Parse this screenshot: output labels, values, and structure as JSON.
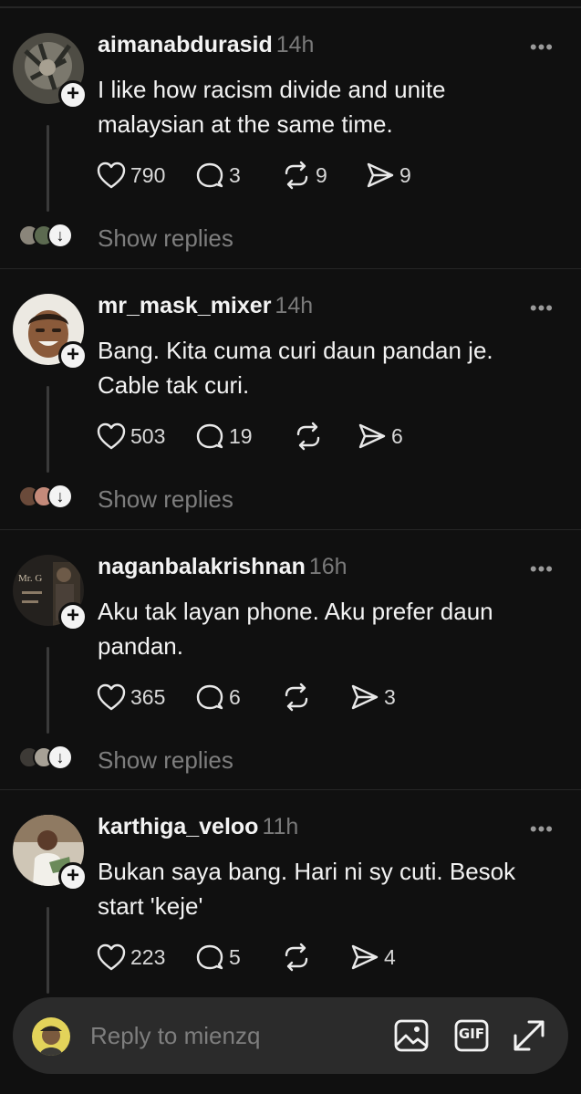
{
  "posts": [
    {
      "username": "aimanabdurasid",
      "time": "14h",
      "text": "I like how racism divide and unite malaysian at the same time.",
      "likes": "790",
      "comments": "3",
      "reposts": "9",
      "shares": "9",
      "show_replies": "Show replies",
      "avatar_colors": [
        "#6d6a62",
        "#3a3b35"
      ]
    },
    {
      "username": "mr_mask_mixer",
      "time": "14h",
      "text": "Bang. Kita cuma curi daun pandan je. Cable tak curi.",
      "likes": "503",
      "comments": "19",
      "reposts": "",
      "shares": "6",
      "show_replies": "Show replies",
      "avatar_colors": [
        "#e8e4dc",
        "#8a5a3a"
      ]
    },
    {
      "username": "naganbalakrishnan",
      "time": "16h",
      "text": "Aku tak layan phone. Aku prefer daun pandan.",
      "likes": "365",
      "comments": "6",
      "reposts": "",
      "shares": "3",
      "show_replies": "Show replies",
      "avatar_colors": [
        "#2a2622",
        "#55483a"
      ]
    },
    {
      "username": "karthiga_veloo",
      "time": "11h",
      "text": "Bukan saya bang. Hari ni sy cuti. Besok start 'keje'",
      "likes": "223",
      "comments": "5",
      "reposts": "",
      "shares": "4",
      "show_replies": "",
      "avatar_colors": [
        "#d9d2c4",
        "#6b8a5a"
      ]
    }
  ],
  "avatar_logo_text": "Mr. G",
  "composer": {
    "placeholder": "Reply to mienzq",
    "gif_label": "GIF"
  },
  "icons": {
    "more": "more-horizontal-icon",
    "like": "heart-icon",
    "comment": "comment-icon",
    "repost": "repost-icon",
    "share": "share-icon",
    "follow": "plus-icon",
    "expand_replies": "chevron-down-icon",
    "image": "image-icon",
    "gif": "gif-icon",
    "expand": "expand-icon"
  },
  "colors": {
    "background": "#101010",
    "text": "#f3f3f3",
    "muted": "#7e7e7e",
    "divider": "#262626",
    "composer_bg": "#2b2b2b"
  }
}
